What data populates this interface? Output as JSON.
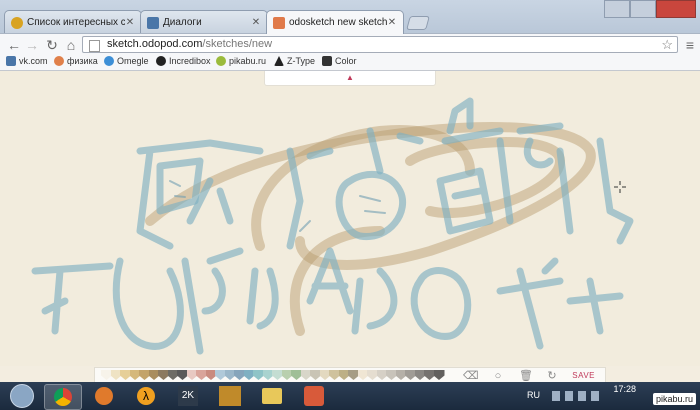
{
  "browser": {
    "tabs": [
      {
        "title": "Список интересных сайт",
        "favicon_color": "#d8a322"
      },
      {
        "title": "Диалоги",
        "favicon_color": "#4a76a8"
      },
      {
        "title": "odosketch   new sketch",
        "favicon_color": "#e07a4a"
      }
    ],
    "url_host": "sketch.odopod.com",
    "url_path": "/sketches/new",
    "bookmarks": [
      {
        "label": "vk.com",
        "icon_color": "#4a76a8"
      },
      {
        "label": "физика",
        "icon_color": "#e0804a"
      },
      {
        "label": "Omegle",
        "icon_color": "#3d8fd6"
      },
      {
        "label": "Incredibox",
        "icon_color": "#222222"
      },
      {
        "label": "pikabu.ru",
        "icon_color": "#9bbb3c"
      },
      {
        "label": "Z-Type",
        "icon_color": "#222222"
      },
      {
        "label": "Color",
        "icon_color": "#333333"
      }
    ]
  },
  "sketch": {
    "palette_colors": [
      "#f7f3ea",
      "#efe3c4",
      "#e6cf98",
      "#d5b87b",
      "#c3a36a",
      "#a98d5e",
      "#8c7a60",
      "#6e6c66",
      "#5a5a5a",
      "#e8c9c2",
      "#d9a49a",
      "#c98b7f",
      "#b0c9d9",
      "#9bb7c9",
      "#86a5bb",
      "#7fb0c2",
      "#8fc4c7",
      "#a9d3cf",
      "#c4ddd2",
      "#b9cfae",
      "#9fbf97",
      "#d8d6c9",
      "#c9c4b5",
      "#e3d9c0",
      "#cfc29d",
      "#bdb086",
      "#a69d85",
      "#f0e6d4",
      "#e5ddd0",
      "#d6d0c6",
      "#c8c3ba",
      "#b5b0a8",
      "#a09c96",
      "#8a8783",
      "#75726f",
      "#62605e"
    ],
    "save_label": "SAVE",
    "tools": [
      "eraser-icon",
      "brush-circle-icon",
      "trash-icon",
      "undo-icon"
    ]
  },
  "taskbar": {
    "language": "RU",
    "clock": "17:28",
    "watermark": "pikabu.ru",
    "apps": [
      {
        "name": "start-orb",
        "color": "#8aa6c4"
      },
      {
        "name": "chrome",
        "color": "#d8d4c4"
      },
      {
        "name": "firefox",
        "color": "#e07a2c"
      },
      {
        "name": "half-life",
        "color": "#f0a020"
      },
      {
        "name": "2k",
        "color": "#4a7fb8"
      },
      {
        "name": "game-lovers",
        "color": "#c08a2a"
      },
      {
        "name": "explorer",
        "color": "#e8c85a"
      },
      {
        "name": "subway-surfers",
        "color": "#d85a3a"
      }
    ]
  }
}
